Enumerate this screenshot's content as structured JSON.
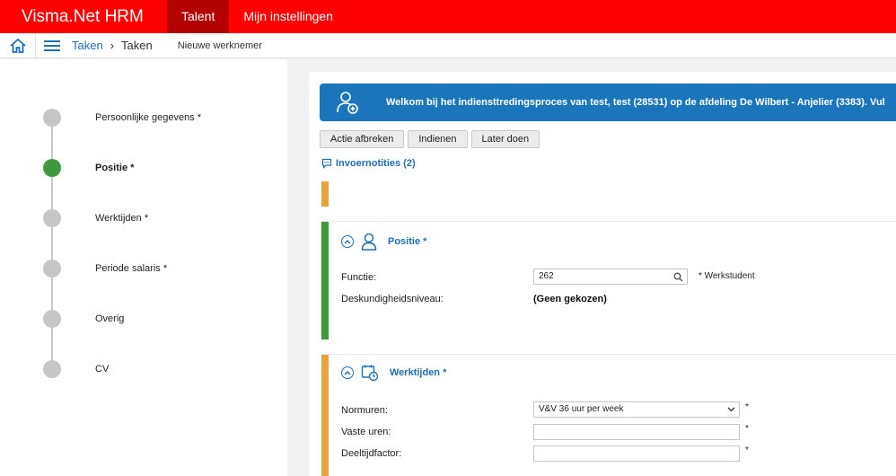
{
  "app": {
    "title": "Visma.Net HRM",
    "nav": [
      {
        "label": "Talent",
        "active": true
      },
      {
        "label": "Mijn instellingen",
        "active": false
      }
    ],
    "brand_color": "#ff0000"
  },
  "breadcrumb": {
    "link": "Taken",
    "separator": "›",
    "current": "Taken",
    "sub": "Nieuwe werknemer"
  },
  "steps": [
    {
      "label": "Persoonlijke gegevens *",
      "active": false
    },
    {
      "label": "Positie *",
      "active": true
    },
    {
      "label": "Werktijden *",
      "active": false
    },
    {
      "label": "Periode salaris *",
      "active": false
    },
    {
      "label": "Overig",
      "active": false
    },
    {
      "label": "CV",
      "active": false
    }
  ],
  "welcome": {
    "text": "Welkom bij het indiensttredingsproces van test, test (28531) op de afdeling De Wilbert - Anjelier (3383). Vul"
  },
  "buttons": {
    "cancel": "Actie afbreken",
    "submit": "Indienen",
    "later": "Later doen"
  },
  "notes": {
    "label": "Invoernotities (2)"
  },
  "positie": {
    "title": "Positie *",
    "functie_label": "Functie:",
    "functie_value": "262",
    "functie_after": "* Werkstudent",
    "niveau_label": "Deskundigheidsniveau:",
    "niveau_value": "(Geen gekozen)"
  },
  "werktijden": {
    "title": "Werktijden *",
    "normuren_label": "Normuren:",
    "normuren_value": "V&V 36 uur per week",
    "vaste_label": "Vaste uren:",
    "vaste_value": "",
    "factor_label": "Deeltijdfactor:",
    "factor_value": "",
    "required_mark": "*"
  },
  "colors": {
    "accent_blue": "#1b75bb",
    "link_blue": "#1f6fb5",
    "step_active": "#3d9a3d",
    "section_green": "#3d9a3d",
    "section_orange": "#e8a33a"
  }
}
